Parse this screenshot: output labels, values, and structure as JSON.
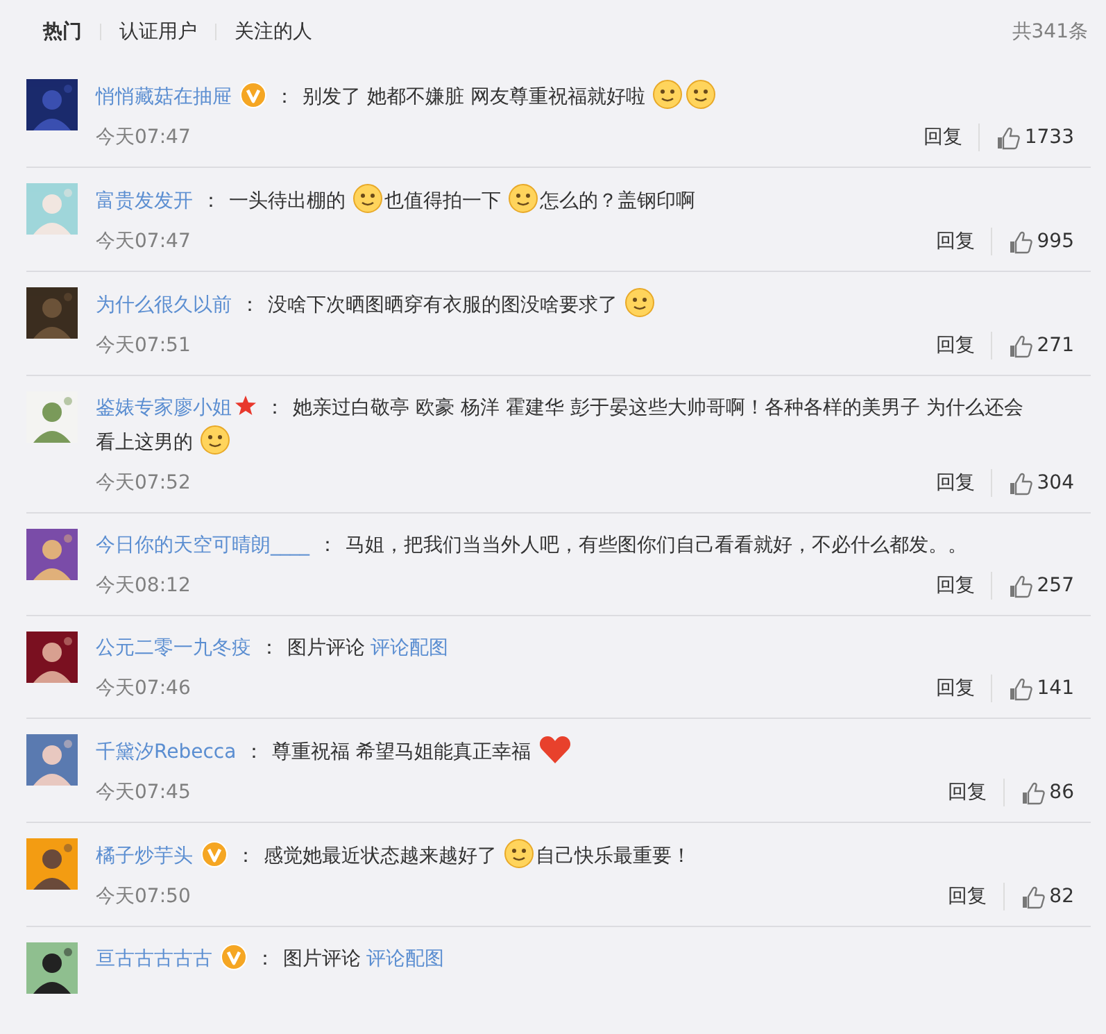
{
  "tabs": [
    {
      "label": "热门",
      "selected": true
    },
    {
      "label": "认证用户",
      "selected": false
    },
    {
      "label": "关注的人",
      "selected": false
    }
  ],
  "total": "共341条",
  "comments": [
    {
      "name": "悄悄藏菇在抽屉",
      "verified": true,
      "colon": "：",
      "content": [
        {
          "kind": "text",
          "text": "别发了 她都不嫌脏 网友尊重祝福就好啦"
        },
        {
          "kind": "emoji"
        },
        {
          "kind": "emoji"
        }
      ],
      "time": "今天07:47",
      "reply": "回复",
      "likes": "1733"
    },
    {
      "name": "富贵发发开",
      "colon": "：",
      "content": [
        {
          "kind": "text",
          "text": "一头待出棚的"
        },
        {
          "kind": "emoji"
        },
        {
          "kind": "text",
          "text": "也值得拍一下"
        },
        {
          "kind": "emoji"
        },
        {
          "kind": "text",
          "text": "怎么的？盖钢印啊"
        }
      ],
      "time": "今天07:47",
      "reply": "回复",
      "likes": "995"
    },
    {
      "name": "为什么很久以前",
      "colon": "：",
      "content": [
        {
          "kind": "text",
          "text": "没啥下次晒图晒穿有衣服的图没啥要求了"
        },
        {
          "kind": "emoji"
        }
      ],
      "time": "今天07:51",
      "reply": "回复",
      "likes": "271"
    },
    {
      "name": "鉴婊专家廖小姐",
      "starred": true,
      "colon": "：",
      "content": [
        {
          "kind": "text",
          "text": "她亲过白敬亭 欧豪 杨洋 霍建华 彭于晏这些大帅哥啊！各种各样的美男子 为什么还会"
        },
        {
          "kind": "text",
          "text": "看上这男的"
        },
        {
          "kind": "emoji"
        }
      ],
      "time": "今天07:52",
      "reply": "回复",
      "likes": "304"
    },
    {
      "name": "今日你的天空可晴朗____",
      "colon": "：",
      "content": [
        {
          "kind": "text",
          "text": "马姐，把我们当当外人吧，有些图你们自己看看就好，不必什么都发。。"
        }
      ],
      "time": "今天08:12",
      "reply": "回复",
      "likes": "257"
    },
    {
      "name": "公元二零一九冬疫",
      "colon": "：",
      "content": [
        {
          "kind": "text",
          "text": "图片评论"
        },
        {
          "kind": "link",
          "text": "评论配图"
        }
      ],
      "time": "今天07:46",
      "reply": "回复",
      "likes": "141"
    },
    {
      "name": "千黛汐Rebecca",
      "colon": "：",
      "content": [
        {
          "kind": "text",
          "text": "尊重祝福 希望马姐能真正幸福"
        },
        {
          "kind": "heart"
        }
      ],
      "time": "今天07:45",
      "reply": "回复",
      "likes": "86"
    },
    {
      "name": "橘子炒芋头",
      "verified": true,
      "colon": "：",
      "content": [
        {
          "kind": "text",
          "text": "感觉她最近状态越来越好了"
        },
        {
          "kind": "emoji"
        },
        {
          "kind": "text",
          "text": "自己快乐最重要！"
        }
      ],
      "time": "今天07:50",
      "reply": "回复",
      "likes": "82"
    },
    {
      "name": "亘古古古古古",
      "verified": true,
      "colon": "：",
      "content": [
        {
          "kind": "text",
          "text": "图片评论"
        },
        {
          "kind": "link",
          "text": "评论配图"
        }
      ]
    }
  ]
}
